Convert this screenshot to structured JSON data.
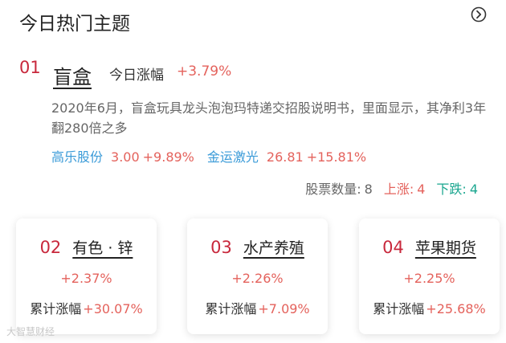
{
  "header": {
    "title": "今日热门主题",
    "more_icon": "chevron-right-circle-icon"
  },
  "featured": {
    "rank": "01",
    "topic": "盲盒",
    "today_label": "今日涨幅",
    "today_value": "+3.79%",
    "description": "2020年6月，盲盒玩具龙头泡泡玛特递交招股说明书，里面显示，其净利3年翻280倍之多",
    "stocks": [
      {
        "name": "高乐股份",
        "price": "3.00",
        "change": "+9.89%"
      },
      {
        "name": "金运激光",
        "price": "26.81",
        "change": "+15.81%"
      }
    ],
    "counts": {
      "total_label": "股票数量:",
      "total": "8",
      "up_label": "上涨:",
      "up": "4",
      "down_label": "下跌:",
      "down": "4"
    }
  },
  "cards": [
    {
      "rank": "02",
      "name": "有色 · 锌",
      "change": "+2.37%",
      "cum_label": "累计涨幅",
      "cum_value": "+30.07%"
    },
    {
      "rank": "03",
      "name": "水产养殖",
      "change": "+2.26%",
      "cum_label": "累计涨幅",
      "cum_value": "+7.09%"
    },
    {
      "rank": "04",
      "name": "苹果期货",
      "change": "+2.25%",
      "cum_label": "累计涨幅",
      "cum_value": "+25.68%"
    }
  ],
  "watermark": "大智慧财经",
  "colors": {
    "rank": "#c8283c",
    "up": "#e4625c",
    "down": "#1aa68f",
    "stock_link": "#3b9bd8"
  }
}
